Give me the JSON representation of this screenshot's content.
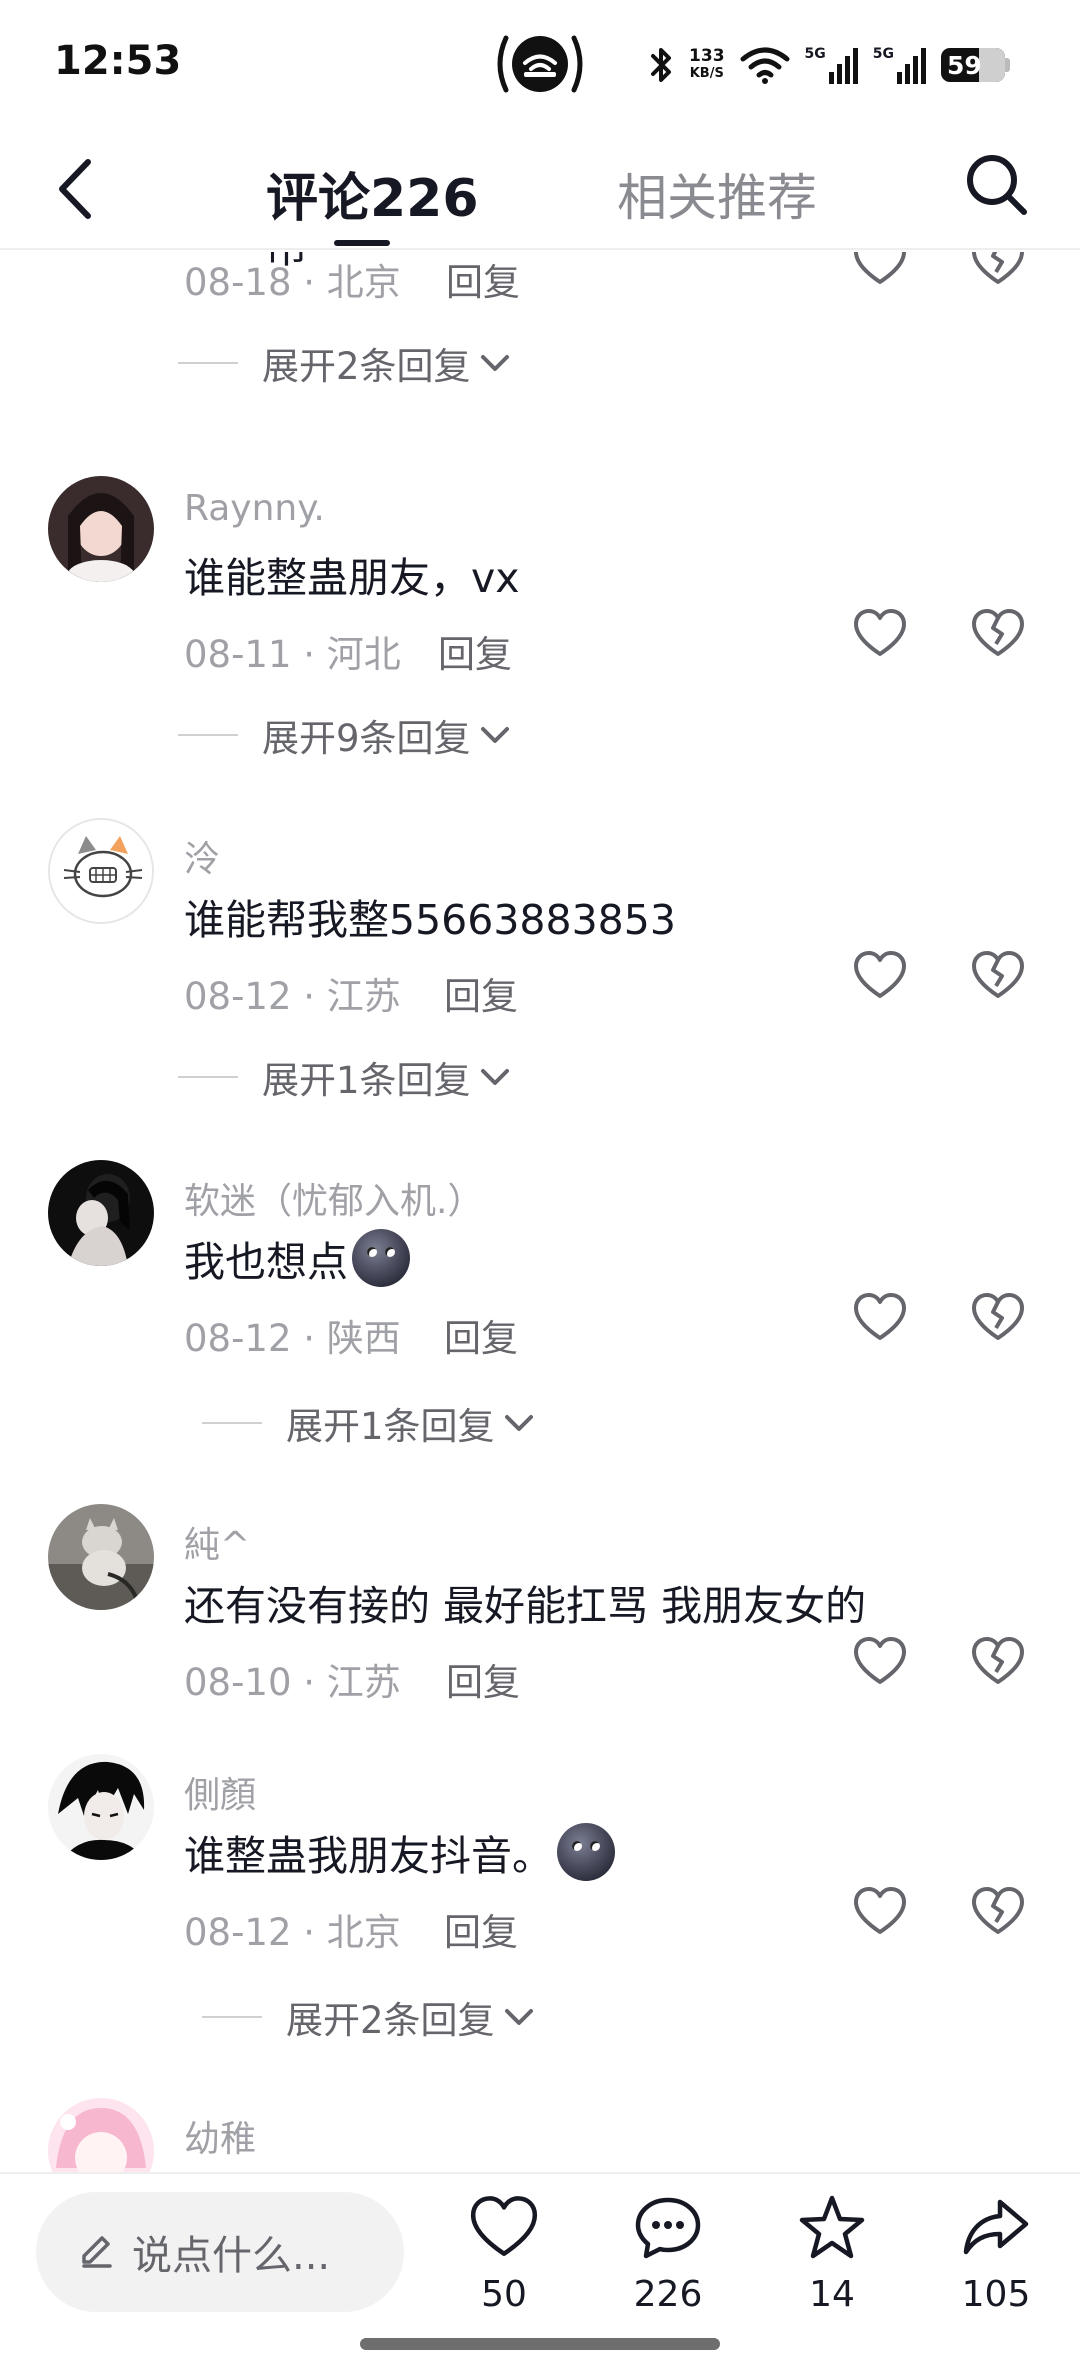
{
  "status_bar": {
    "time": "12:53",
    "net_speed_value": "133",
    "net_speed_unit": "KB/S",
    "signal_1": "5G",
    "signal_2": "5G",
    "battery": "59"
  },
  "header": {
    "tab_comments": "评论226",
    "tab_related": "相关推荐",
    "back_icon": "chevron-left-icon",
    "search_icon": "search-icon"
  },
  "partial_comment": {
    "text_cut": "一一吊",
    "date_location": "08-18 · 北京",
    "reply": "回复",
    "expand": "展开2条回复"
  },
  "comments": [
    {
      "username": "Raynny.",
      "text": "谁能整蛊朋友，vx",
      "emoji": false,
      "date_location": "08-11 · 河北",
      "reply": "回复",
      "expand": "展开9条回复"
    },
    {
      "username": "泠",
      "text": "谁能帮我整55663883853",
      "emoji": false,
      "date_location": "08-12 · 江苏",
      "reply": "回复",
      "expand": "展开1条回复"
    },
    {
      "username": "软迷（忧郁入机.）",
      "text": "我也想点",
      "emoji": true,
      "date_location": "08-12 · 陕西",
      "reply": "回复",
      "expand": "展开1条回复"
    },
    {
      "username": "純^",
      "text": "还有没有接的 最好能扛骂 我朋友女的",
      "emoji": false,
      "date_location": "08-10 · 江苏",
      "reply": "回复",
      "expand": ""
    },
    {
      "username": "側顏",
      "text": "谁整蛊我朋友抖音。",
      "emoji": true,
      "date_location": "08-12 · 北京",
      "reply": "回复",
      "expand": "展开2条回复"
    },
    {
      "username": "幼稚",
      "text": "",
      "emoji": false,
      "date_location": "",
      "reply": "",
      "expand": ""
    }
  ],
  "bottom_bar": {
    "input_placeholder": "说点什么...",
    "likes": "50",
    "comments": "226",
    "favorites": "14",
    "shares": "105"
  }
}
